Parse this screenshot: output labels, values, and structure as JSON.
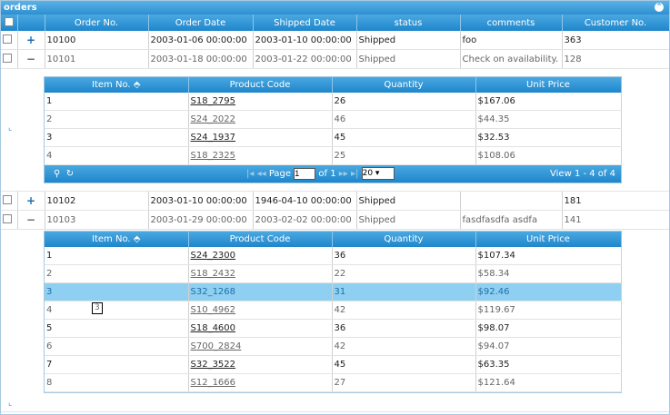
{
  "grid_title": "orders",
  "columns": [
    "Order No.",
    "Order Date",
    "Shipped Date",
    "status",
    "comments",
    "Customer No."
  ],
  "orders": [
    {
      "order_no": "10100",
      "order_date": "2003-01-06 00:00:00",
      "shipped_date": "2003-01-10 00:00:00",
      "status": "Shipped",
      "comments": "foo",
      "customer_no": "363",
      "toggle": "+"
    },
    {
      "order_no": "10101",
      "order_date": "2003-01-18 00:00:00",
      "shipped_date": "2003-01-22 00:00:00",
      "status": "Shipped",
      "comments": "Check on availability.",
      "customer_no": "128",
      "toggle": "−"
    },
    {
      "order_no": "10102",
      "order_date": "2003-01-10 00:00:00",
      "shipped_date": "1946-04-10 00:00:00",
      "status": "Shipped",
      "comments": "",
      "customer_no": "181",
      "toggle": "+"
    },
    {
      "order_no": "10103",
      "order_date": "2003-01-29 00:00:00",
      "shipped_date": "2003-02-02 00:00:00",
      "status": "Shipped",
      "comments": "fasdfasdfa asdfa",
      "customer_no": "141",
      "toggle": "−"
    }
  ],
  "sub_columns": [
    "Item No. ⬘",
    "Product Code",
    "Quantity",
    "Unit Price"
  ],
  "subgrid_1": {
    "items": [
      {
        "item": "1",
        "code": "S18_2795",
        "qty": "26",
        "price": "$167.06"
      },
      {
        "item": "2",
        "code": "S24_2022",
        "qty": "46",
        "price": "$44.35"
      },
      {
        "item": "3",
        "code": "S24_1937",
        "qty": "45",
        "price": "$32.53"
      },
      {
        "item": "4",
        "code": "S18_2325",
        "qty": "25",
        "price": "$108.06"
      }
    ],
    "pager": {
      "page_label": "Page",
      "page_value": "1",
      "of_label": "of 1",
      "rows": "20",
      "view": "View 1 - 4 of 4"
    }
  },
  "subgrid_2": {
    "items": [
      {
        "item": "1",
        "code": "S24_2300",
        "qty": "36",
        "price": "$107.34"
      },
      {
        "item": "2",
        "code": "S18_2432",
        "qty": "22",
        "price": "$58.34"
      },
      {
        "item": "3",
        "code": "S32_1268",
        "qty": "31",
        "price": "$92.46"
      },
      {
        "item": "4",
        "code": "S10_4962",
        "qty": "42",
        "price": "$119.67"
      },
      {
        "item": "5",
        "code": "S18_4600",
        "qty": "36",
        "price": "$98.07"
      },
      {
        "item": "6",
        "code": "S700_2824",
        "qty": "42",
        "price": "$94.07"
      },
      {
        "item": "7",
        "code": "S32_3522",
        "qty": "45",
        "price": "$63.35"
      },
      {
        "item": "8",
        "code": "S12_1666",
        "qty": "27",
        "price": "$121.64"
      }
    ],
    "tooltip": "3"
  }
}
